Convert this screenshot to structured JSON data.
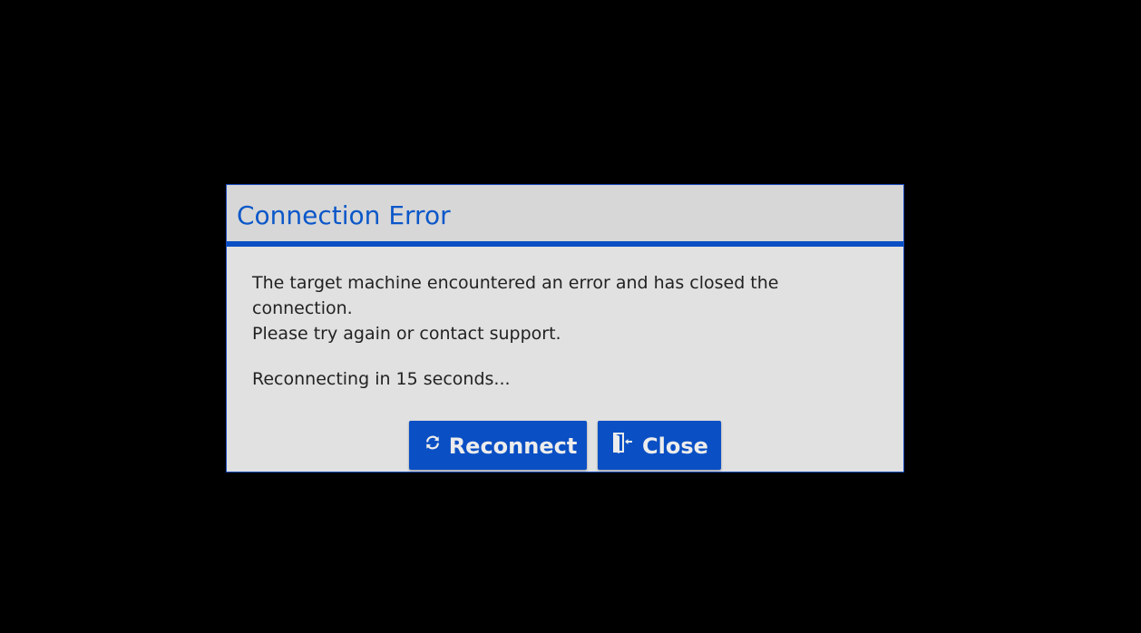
{
  "dialog": {
    "title": "Connection Error",
    "message_line1": "The target machine encountered an error and has closed the connection.",
    "message_line2": "Please try again or contact support.",
    "countdown": "Reconnecting in 15 seconds...",
    "buttons": {
      "reconnect": {
        "label": "Reconnect",
        "icon": "refresh-icon"
      },
      "close": {
        "label": "Close",
        "icon": "exit-door-icon"
      }
    }
  },
  "colors": {
    "background": "#000000",
    "dialog_bg": "#e1e1e1",
    "header_bg": "#d7d7d7",
    "accent": "#0a4fc4",
    "title_text": "#0b57c9",
    "body_text": "#222222",
    "button_text": "#ececec"
  }
}
